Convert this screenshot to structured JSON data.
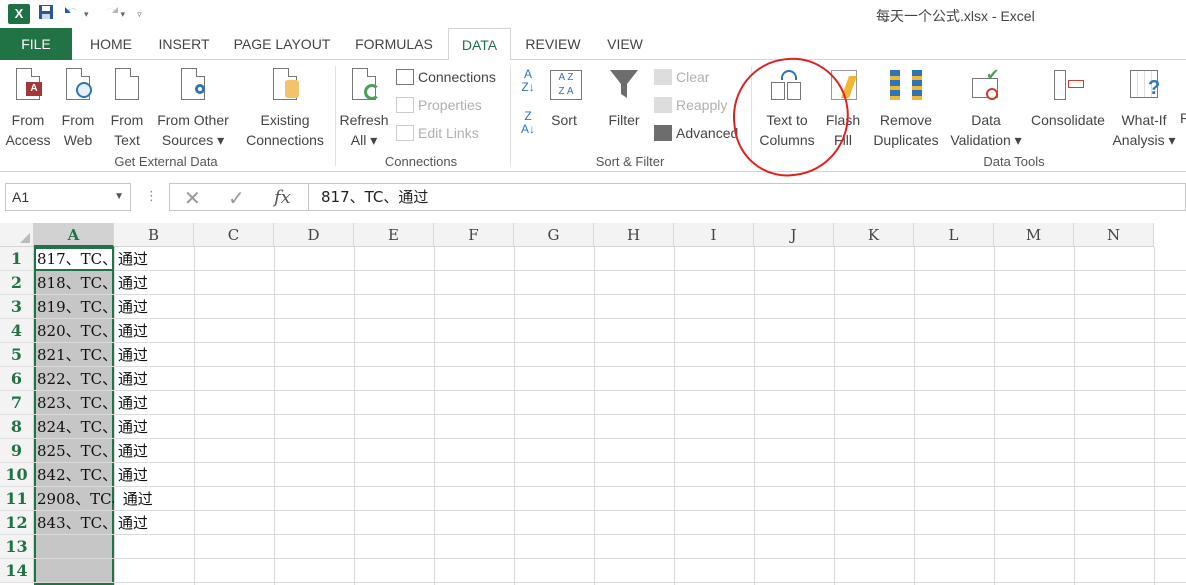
{
  "app": {
    "window_title": "每天一个公式.xlsx - Excel",
    "logo_text": "X"
  },
  "tabs": [
    {
      "label": "FILE"
    },
    {
      "label": "HOME"
    },
    {
      "label": "INSERT"
    },
    {
      "label": "PAGE LAYOUT"
    },
    {
      "label": "FORMULAS"
    },
    {
      "label": "DATA"
    },
    {
      "label": "REVIEW"
    },
    {
      "label": "VIEW"
    }
  ],
  "ribbon": {
    "get_external": {
      "from_access": [
        "From",
        "Access"
      ],
      "from_web": [
        "From",
        "Web"
      ],
      "from_text": [
        "From",
        "Text"
      ],
      "from_other": [
        "From Other",
        "Sources ▾"
      ],
      "label": "Get External Data"
    },
    "existing": [
      "Existing",
      "Connections"
    ],
    "connections": {
      "refresh": [
        "Refresh",
        "All ▾"
      ],
      "connections": "Connections",
      "properties": "Properties",
      "edit_links": "Edit Links",
      "label": "Connections"
    },
    "sort_filter": {
      "sort": "Sort",
      "filter": "Filter",
      "clear": "Clear",
      "reapply": "Reapply",
      "advanced": "Advanced",
      "label": "Sort & Filter"
    },
    "data_tools": {
      "text_to_columns": [
        "Text to",
        "Columns"
      ],
      "flash_fill": [
        "Flash",
        "Fill"
      ],
      "remove_duplicates": [
        "Remove",
        "Duplicates"
      ],
      "data_validation": [
        "Data",
        "Validation ▾"
      ],
      "consolidate": "Consolidate",
      "what_if": [
        "What-If",
        "Analysis ▾"
      ],
      "label": "Data Tools"
    },
    "cut_off_letter": "R"
  },
  "formula_bar": {
    "name_box": "A1",
    "fx": "fx",
    "value": "817、TC、通过"
  },
  "columns": [
    "A",
    "B",
    "C",
    "D",
    "E",
    "F",
    "G",
    "H",
    "I",
    "J",
    "K",
    "L",
    "M",
    "N"
  ],
  "rows": [
    {
      "num": "1",
      "a": "817、TC、",
      "b": "通过"
    },
    {
      "num": "2",
      "a": "818、TC、",
      "b": "通过"
    },
    {
      "num": "3",
      "a": "819、TC、",
      "b": "通过"
    },
    {
      "num": "4",
      "a": "820、TC、",
      "b": "通过"
    },
    {
      "num": "5",
      "a": "821、TC、",
      "b": "通过"
    },
    {
      "num": "6",
      "a": "822、TC、",
      "b": "通过"
    },
    {
      "num": "7",
      "a": "823、TC、",
      "b": "通过"
    },
    {
      "num": "8",
      "a": "824、TC、",
      "b": "通过"
    },
    {
      "num": "9",
      "a": "825、TC、",
      "b": "通过"
    },
    {
      "num": "10",
      "a": "842、TC、",
      "b": "通过"
    },
    {
      "num": "11",
      "a": "2908、TC、",
      "b": " 通过"
    },
    {
      "num": "12",
      "a": "843、TC、",
      "b": "通过"
    },
    {
      "num": "13",
      "a": "",
      "b": ""
    },
    {
      "num": "14",
      "a": "",
      "b": ""
    }
  ],
  "colors": {
    "excel_green": "#217346",
    "annotation_red": "#e02020"
  }
}
